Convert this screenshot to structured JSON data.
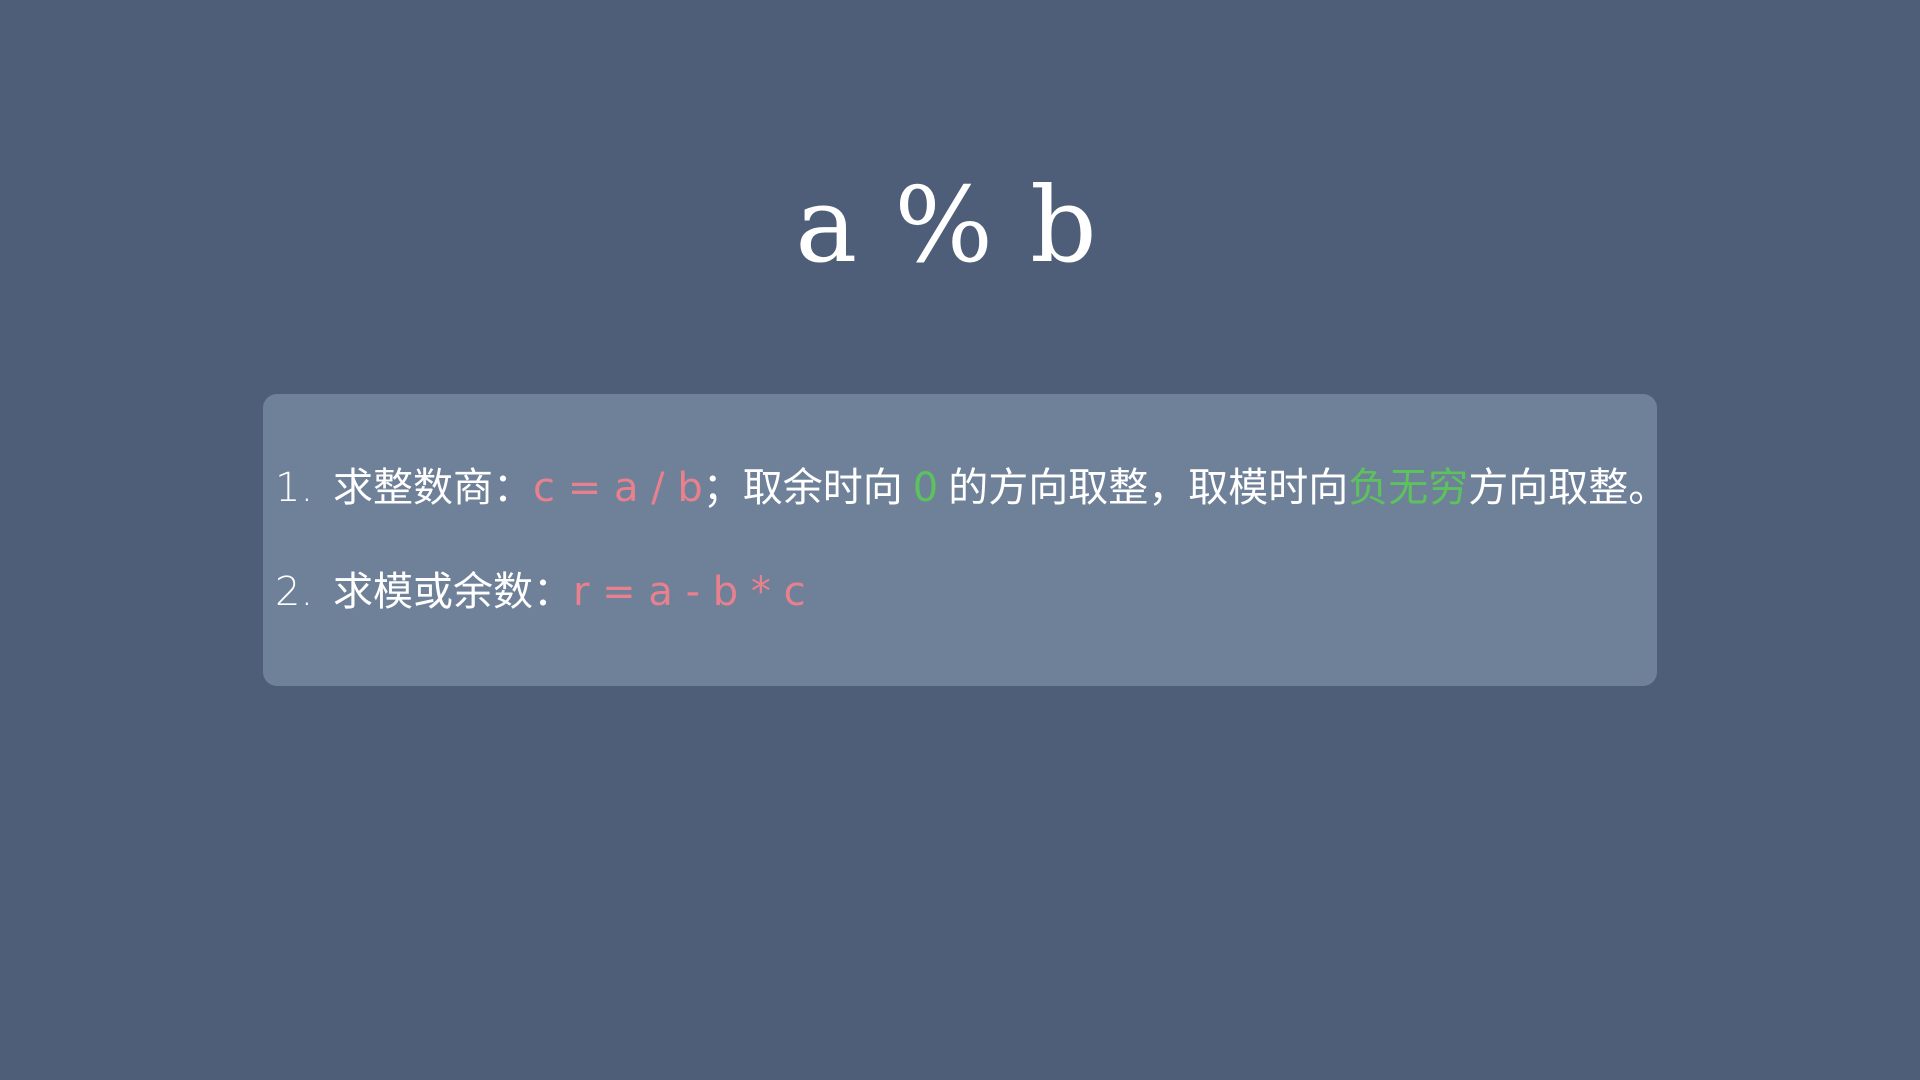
{
  "slide": {
    "title": "a % b"
  },
  "list": {
    "item1": {
      "number": "1.",
      "label": "求整数商：",
      "formula": "c = a / b",
      "text1": "；取余时向",
      "zero": "0",
      "text2": "的方向取整，取模时向",
      "neg_inf": "负无穷",
      "text3": "方向取整。"
    },
    "item2": {
      "number": "2.",
      "label": "求模或余数：",
      "formula": "r = a - b * c"
    }
  },
  "colors": {
    "background": "#4f5e78",
    "box": "#6f8099",
    "formula": "#e8808e",
    "highlight": "#5cc25e",
    "text": "#ffffff"
  }
}
